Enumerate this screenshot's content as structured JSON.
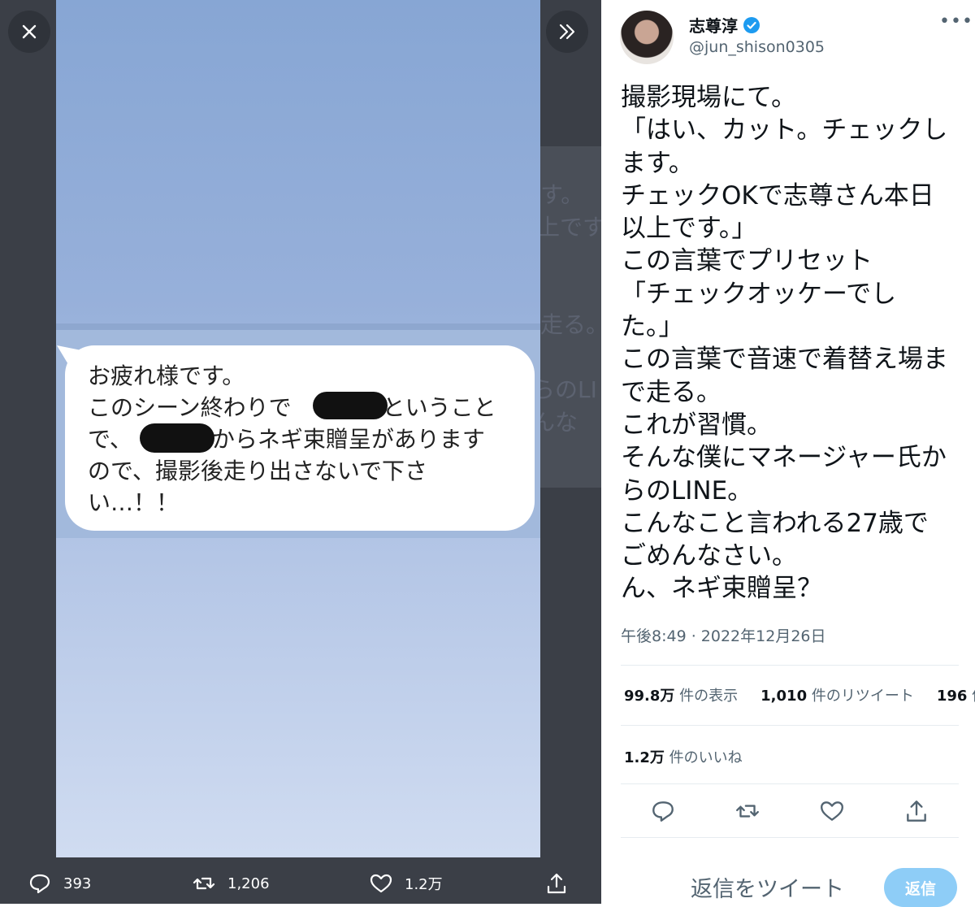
{
  "viewer": {
    "ghost_lines": [
      "す。",
      "上です",
      "走る。",
      "らのLI",
      "んな"
    ],
    "line_message": {
      "lines": [
        "お疲れ様です。",
        "このシーン終わりで　　　　ということ",
        "で、　　　　からネギ束贈呈があります",
        "ので、撮影後走り出さないで下さ",
        "い…！！"
      ]
    },
    "bottom_bar": {
      "reply_count": "393",
      "retweet_count": "1,206",
      "like_count": "1.2万"
    }
  },
  "tweet": {
    "display_name": "志尊淳",
    "handle": "@jun_shison0305",
    "lines": [
      "撮影現場にて。",
      "「はい、カット。チェックし",
      "ます。",
      "チェックOKで志尊さん本日",
      "以上です。」",
      "この言葉でプリセット",
      "「チェックオッケーでし",
      "た。」",
      "この言葉で音速で着替え場ま",
      "で走る。",
      "これが習慣。",
      "そんな僕にマネージャー氏か",
      "らのLINE。",
      "こんなこと言われる27歳で",
      "ごめんなさい。",
      "ん、ネギ束贈呈？"
    ],
    "timestamp": "午後8:49 · 2022年12月26日",
    "stats": {
      "views_value": "99.8万",
      "views_label": "件の表示",
      "retweets_value": "1,010",
      "retweets_label": "件のリツイート",
      "quotes_value": "196",
      "quotes_label": "件",
      "likes_value": "1.2万",
      "likes_label": "件のいいね"
    }
  },
  "reply": {
    "placeholder": "返信をツイート",
    "button_label": "返信"
  },
  "colors": {
    "verified": "#1d9bf0",
    "viewer_bg": "#3b3f47",
    "reply_button": "#8ecdf7"
  }
}
